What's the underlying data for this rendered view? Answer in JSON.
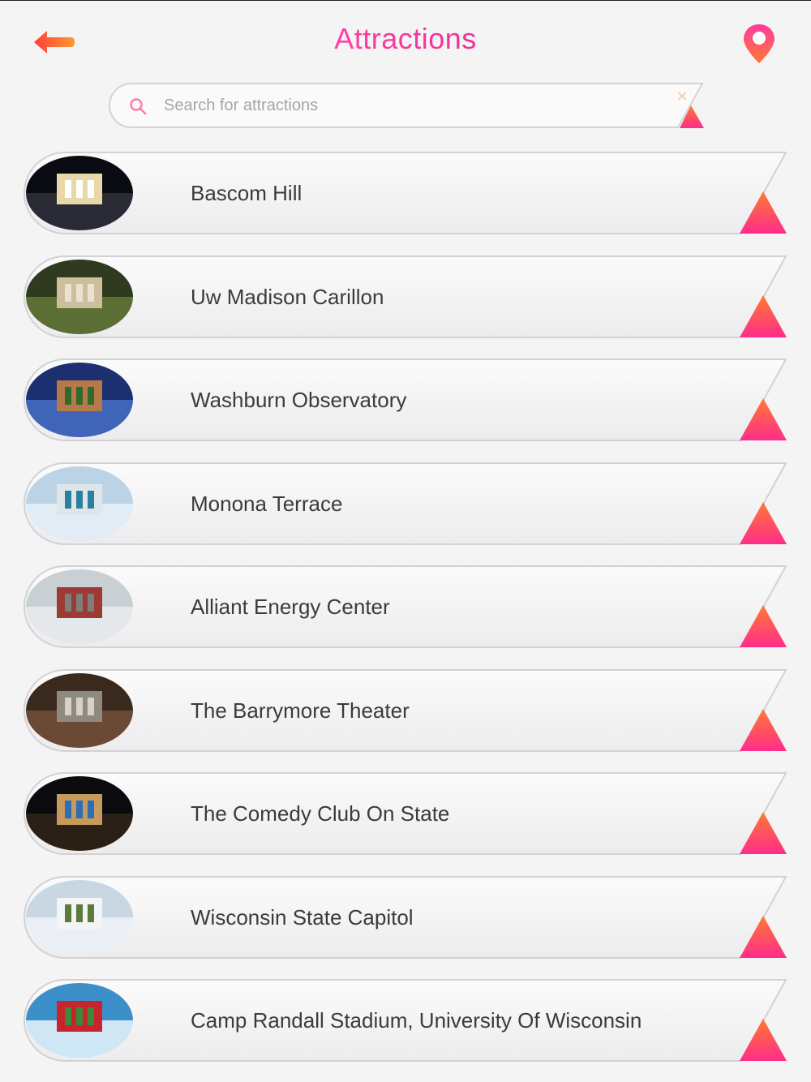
{
  "header": {
    "title": "Attractions",
    "back_icon": "back-arrow-icon",
    "map_icon": "map-pin-icon"
  },
  "search": {
    "placeholder": "Search for attractions",
    "value": "",
    "search_icon": "search-icon",
    "clear_icon": "clear-icon"
  },
  "colors": {
    "accent_pink": "#ff2d8a",
    "accent_orange": "#ff8a2a",
    "title_gradient_start": "#ff3fa4",
    "title_gradient_end": "#f0309a",
    "background": "#f4f4f5"
  },
  "attractions": [
    {
      "name": "Bascom Hill",
      "thumbnail": "night building with statue"
    },
    {
      "name": "Uw Madison Carillon",
      "thumbnail": "stone arch with ivy"
    },
    {
      "name": "Washburn Observatory",
      "thumbnail": "observatory dome at dusk"
    },
    {
      "name": "Monona Terrace",
      "thumbnail": "city skyline over lake"
    },
    {
      "name": "Alliant Energy Center",
      "thumbnail": "red building and parking lot"
    },
    {
      "name": "The Barrymore Theater",
      "thumbnail": "theater marquee"
    },
    {
      "name": "The Comedy Club On State",
      "thumbnail": "dark club interior with lights"
    },
    {
      "name": "Wisconsin State Capitol",
      "thumbnail": "white capitol dome"
    },
    {
      "name": "Camp Randall Stadium, University Of Wisconsin",
      "thumbnail": "red stadium crowd"
    }
  ]
}
